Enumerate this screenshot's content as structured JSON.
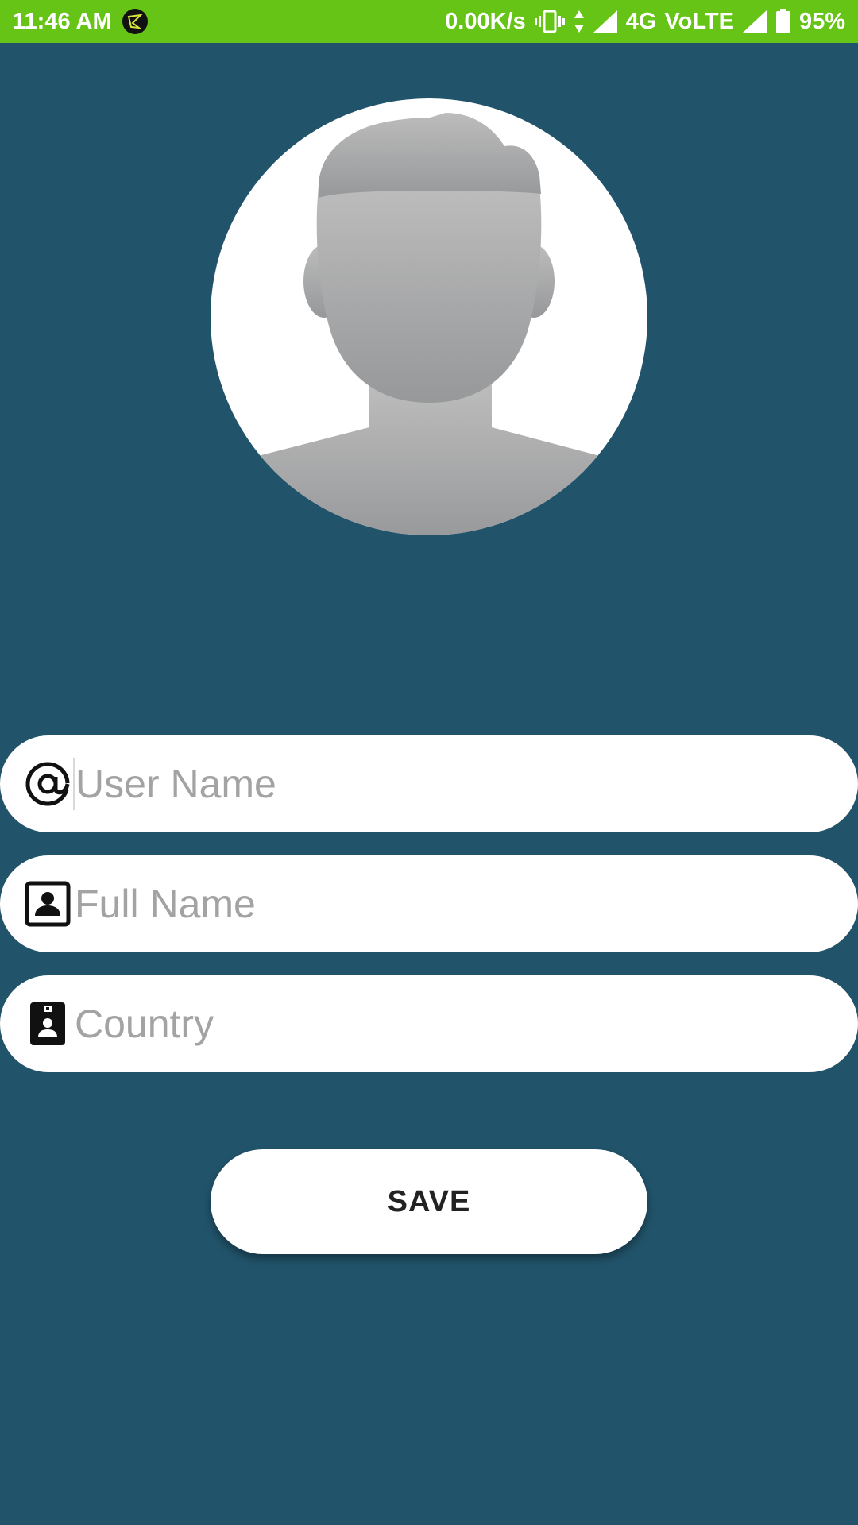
{
  "status_bar": {
    "time": "11:46 AM",
    "network_speed": "0.00K/s",
    "network_type": "4G",
    "volte": "VoLTE",
    "battery": "95%",
    "background_color": "#66c417",
    "icons": [
      "app-notification-icon",
      "vibrate-icon",
      "data-arrows-icon",
      "signal-icon",
      "signal-icon-2",
      "battery-icon"
    ]
  },
  "avatar": {
    "icon": "default-user-avatar-icon"
  },
  "form": {
    "username": {
      "icon": "at-sign-icon",
      "placeholder": "User Name",
      "value": ""
    },
    "fullname": {
      "icon": "contact-card-icon",
      "placeholder": "Full Name",
      "value": ""
    },
    "country": {
      "icon": "badge-icon",
      "placeholder": "Country",
      "value": ""
    }
  },
  "actions": {
    "save_label": "SAVE"
  },
  "colors": {
    "background": "#21536a",
    "field_background": "#ffffff",
    "placeholder": "#a3a3a3"
  }
}
